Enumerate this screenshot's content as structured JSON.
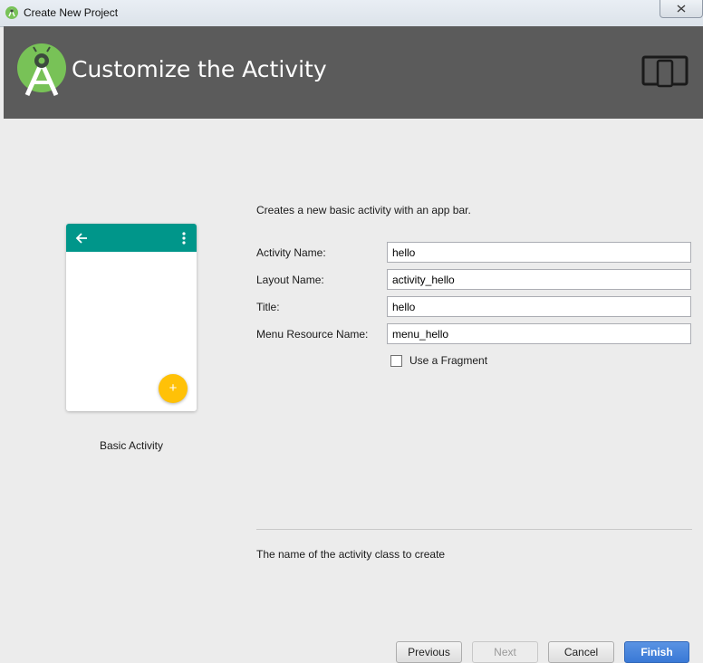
{
  "window": {
    "title": "Create New Project"
  },
  "header": {
    "title": "Customize the Activity"
  },
  "template": {
    "label": "Basic Activity"
  },
  "form": {
    "description": "Creates a new basic activity with an app bar.",
    "fields": [
      {
        "label": "Activity Name:",
        "value": "hello"
      },
      {
        "label": "Layout Name:",
        "value": "activity_hello"
      },
      {
        "label": "Title:",
        "value": "hello"
      },
      {
        "label": "Menu Resource Name:",
        "value": "menu_hello"
      }
    ],
    "fragment_checkbox": {
      "label": "Use a Fragment",
      "checked": false
    },
    "hint": "The name of the activity class to create"
  },
  "buttons": {
    "previous": "Previous",
    "next": "Next",
    "cancel": "Cancel",
    "finish": "Finish"
  },
  "icons": {
    "app": "android-studio-icon",
    "close": "close-icon",
    "logo": "android-studio-logo",
    "device": "phone-tablet-icon",
    "back": "arrow-back-icon",
    "more": "more-vert-icon",
    "fab": "plus-icon"
  },
  "colors": {
    "header_bg": "#5b5b5b",
    "appbar": "#00968a",
    "fab": "#ffc107",
    "logo_green": "#78c257",
    "primary_button": "#3a79d6"
  }
}
